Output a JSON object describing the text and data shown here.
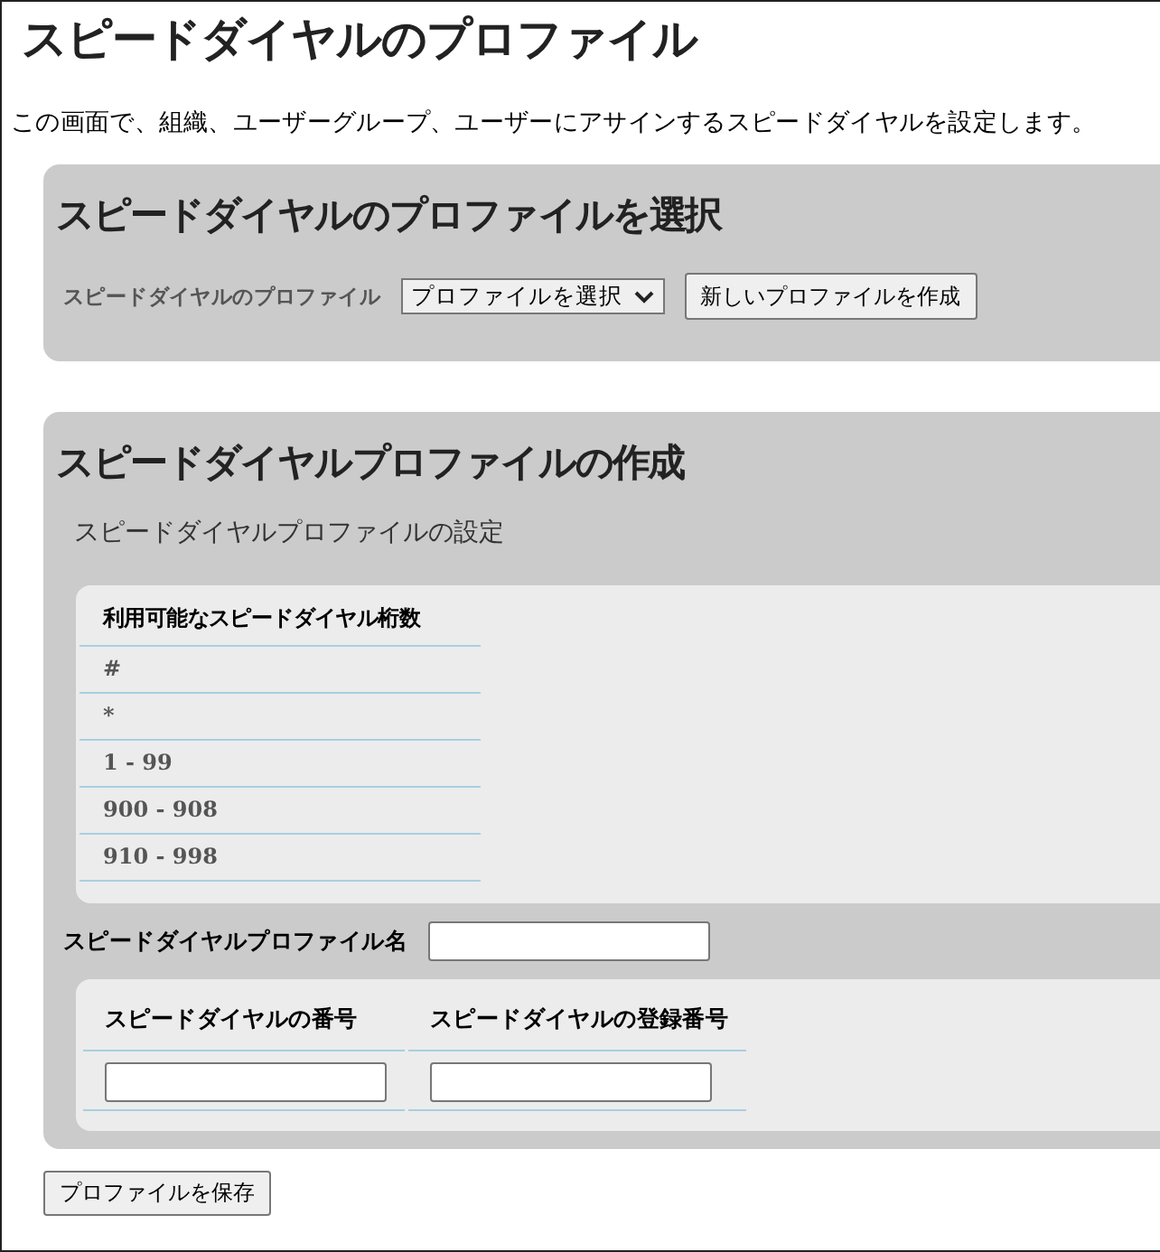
{
  "title": "スピードダイヤルのプロファイル",
  "description": "この画面で、組織、ユーザーグループ、ユーザーにアサインするスピードダイヤルを設定します。",
  "select_panel": {
    "heading": "スピードダイヤルのプロファイルを選択",
    "label": "スピードダイヤルのプロファイル",
    "dropdown": {
      "value": "プロファイルを選択"
    },
    "button": "新しいプロファイルを作成"
  },
  "create_panel": {
    "heading": "スピードダイヤルプロファイルの作成",
    "subheading": "スピードダイヤルプロファイルの設定",
    "digits_table": {
      "header": "利用可能なスピードダイヤル桁数",
      "rows": [
        "#",
        "*",
        "1 - 99",
        "900 - 908",
        "910 - 998"
      ]
    },
    "name_label": "スピードダイヤルプロファイル名",
    "entries_table": {
      "columns": [
        "スピードダイヤルの番号",
        "スピードダイヤルの登録番号"
      ]
    }
  },
  "save_button": "プロファイルを保存"
}
